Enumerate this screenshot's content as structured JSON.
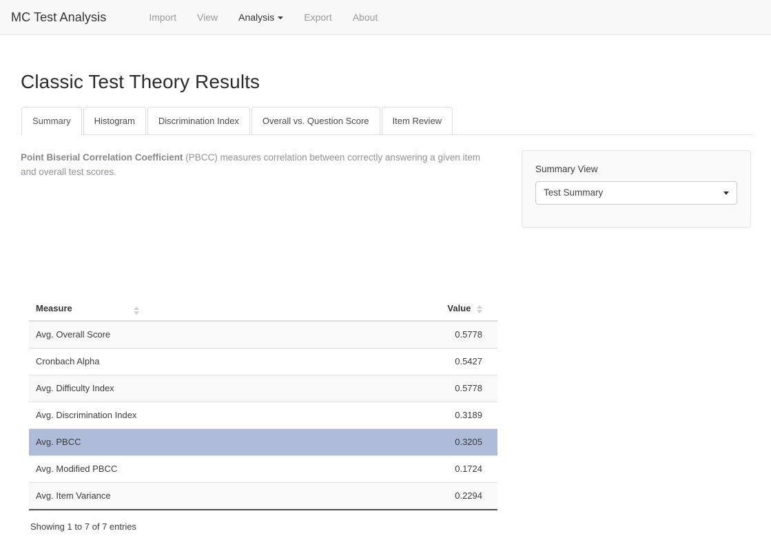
{
  "navbar": {
    "brand": "MC Test Analysis",
    "items": [
      {
        "label": "Import",
        "active": false,
        "caret": false
      },
      {
        "label": "View",
        "active": false,
        "caret": false
      },
      {
        "label": "Analysis",
        "active": true,
        "caret": true
      },
      {
        "label": "Export",
        "active": false,
        "caret": false
      },
      {
        "label": "About",
        "active": false,
        "caret": false
      }
    ]
  },
  "page": {
    "title": "Classic Test Theory Results"
  },
  "tabs": [
    {
      "label": "Summary",
      "active": true
    },
    {
      "label": "Histogram",
      "active": false
    },
    {
      "label": "Discrimination Index",
      "active": false
    },
    {
      "label": "Overall vs. Question Score",
      "active": false
    },
    {
      "label": "Item Review",
      "active": false
    }
  ],
  "description": {
    "strong": "Point Biserial Correlation Coefficient",
    "rest": " (PBCC) measures correlation between correctly answering a given item and overall test scores."
  },
  "summary_view": {
    "label": "Summary View",
    "selected": "Test Summary",
    "options": [
      "Test Summary"
    ]
  },
  "table": {
    "columns": [
      "Measure",
      "Value"
    ],
    "rows": [
      {
        "measure": "Avg. Overall Score",
        "value": "0.5778",
        "selected": false
      },
      {
        "measure": "Cronbach Alpha",
        "value": "0.5427",
        "selected": false
      },
      {
        "measure": "Avg. Difficulty Index",
        "value": "0.5778",
        "selected": false
      },
      {
        "measure": "Avg. Discrimination Index",
        "value": "0.3189",
        "selected": false
      },
      {
        "measure": "Avg. PBCC",
        "value": "0.3205",
        "selected": true
      },
      {
        "measure": "Avg. Modified PBCC",
        "value": "0.1724",
        "selected": false
      },
      {
        "measure": "Avg. Item Variance",
        "value": "0.2294",
        "selected": false
      }
    ],
    "footer": "Showing 1 to 7 of 7 entries",
    "selected_row_color": "#aebbd9"
  }
}
